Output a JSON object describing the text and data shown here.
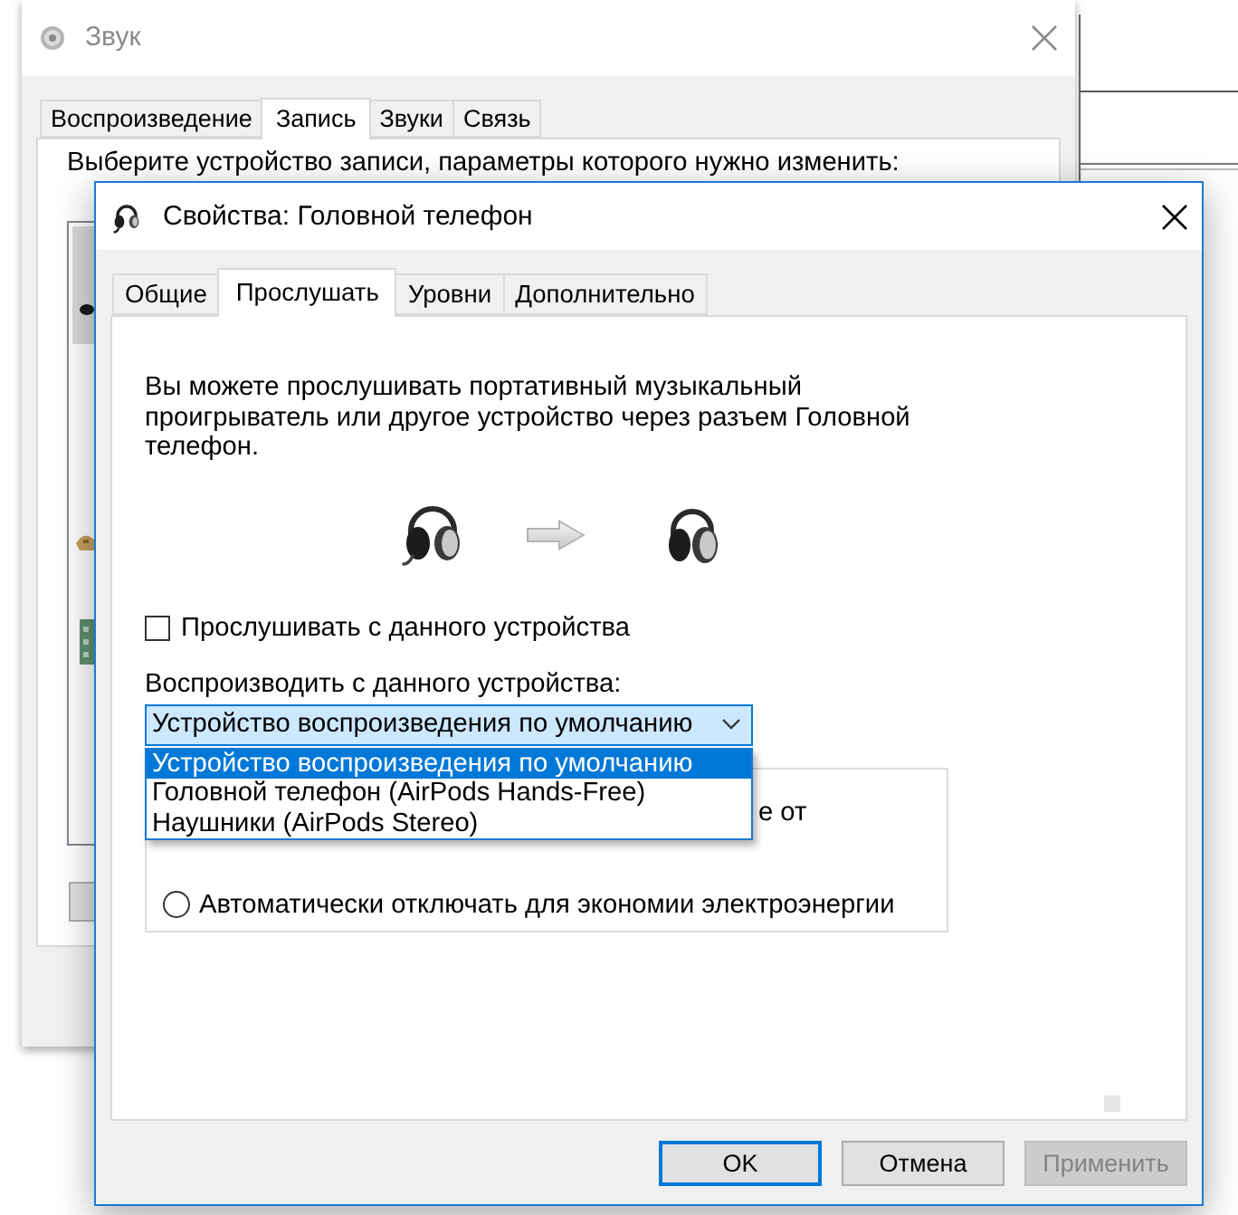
{
  "sound_window": {
    "title": "Звук",
    "active": false,
    "tabs": [
      {
        "label": "Воспроизведение",
        "selected": false
      },
      {
        "label": "Запись",
        "selected": true
      },
      {
        "label": "Звуки",
        "selected": false
      },
      {
        "label": "Связь",
        "selected": false
      }
    ],
    "instruction": "Выберите устройство записи, параметры которого нужно изменить:",
    "devices": [
      {
        "selected": true
      },
      {
        "selected": false
      },
      {
        "selected": false
      }
    ]
  },
  "properties_dialog": {
    "title": "Свойства: Головной телефон",
    "active": true,
    "tabs": [
      {
        "label": "Общие",
        "selected": false
      },
      {
        "label": "Прослушать",
        "selected": true
      },
      {
        "label": "Уровни",
        "selected": false
      },
      {
        "label": "Дополнительно",
        "selected": false
      }
    ],
    "description": "Вы можете прослушивать портативный музыкальный проигрыватель или другое устройство через разъем Головной телефон.",
    "listen_checkbox": {
      "label": "Прослушивать с данного устройства",
      "checked": false
    },
    "playback_label": "Воспроизводить с данного устройства:",
    "playback_select": {
      "value": "Устройство воспроизведения по умолчанию",
      "expanded": true,
      "options": [
        {
          "label": "Устройство воспроизведения по умолчанию",
          "selected": true
        },
        {
          "label": "Головной телефон (AirPods Hands-Free)",
          "selected": false
        },
        {
          "label": "Наушники (AirPods Stereo)",
          "selected": false
        }
      ]
    },
    "power_group": {
      "covered_text": "е от",
      "options": [
        {
          "label": "Автоматически отключать для экономии электроэнергии",
          "selected": false
        }
      ]
    },
    "buttons": [
      {
        "label": "OK",
        "default": true,
        "disabled": false
      },
      {
        "label": "Отмена",
        "default": false,
        "disabled": false
      },
      {
        "label": "Применить",
        "default": false,
        "disabled": true
      }
    ]
  }
}
